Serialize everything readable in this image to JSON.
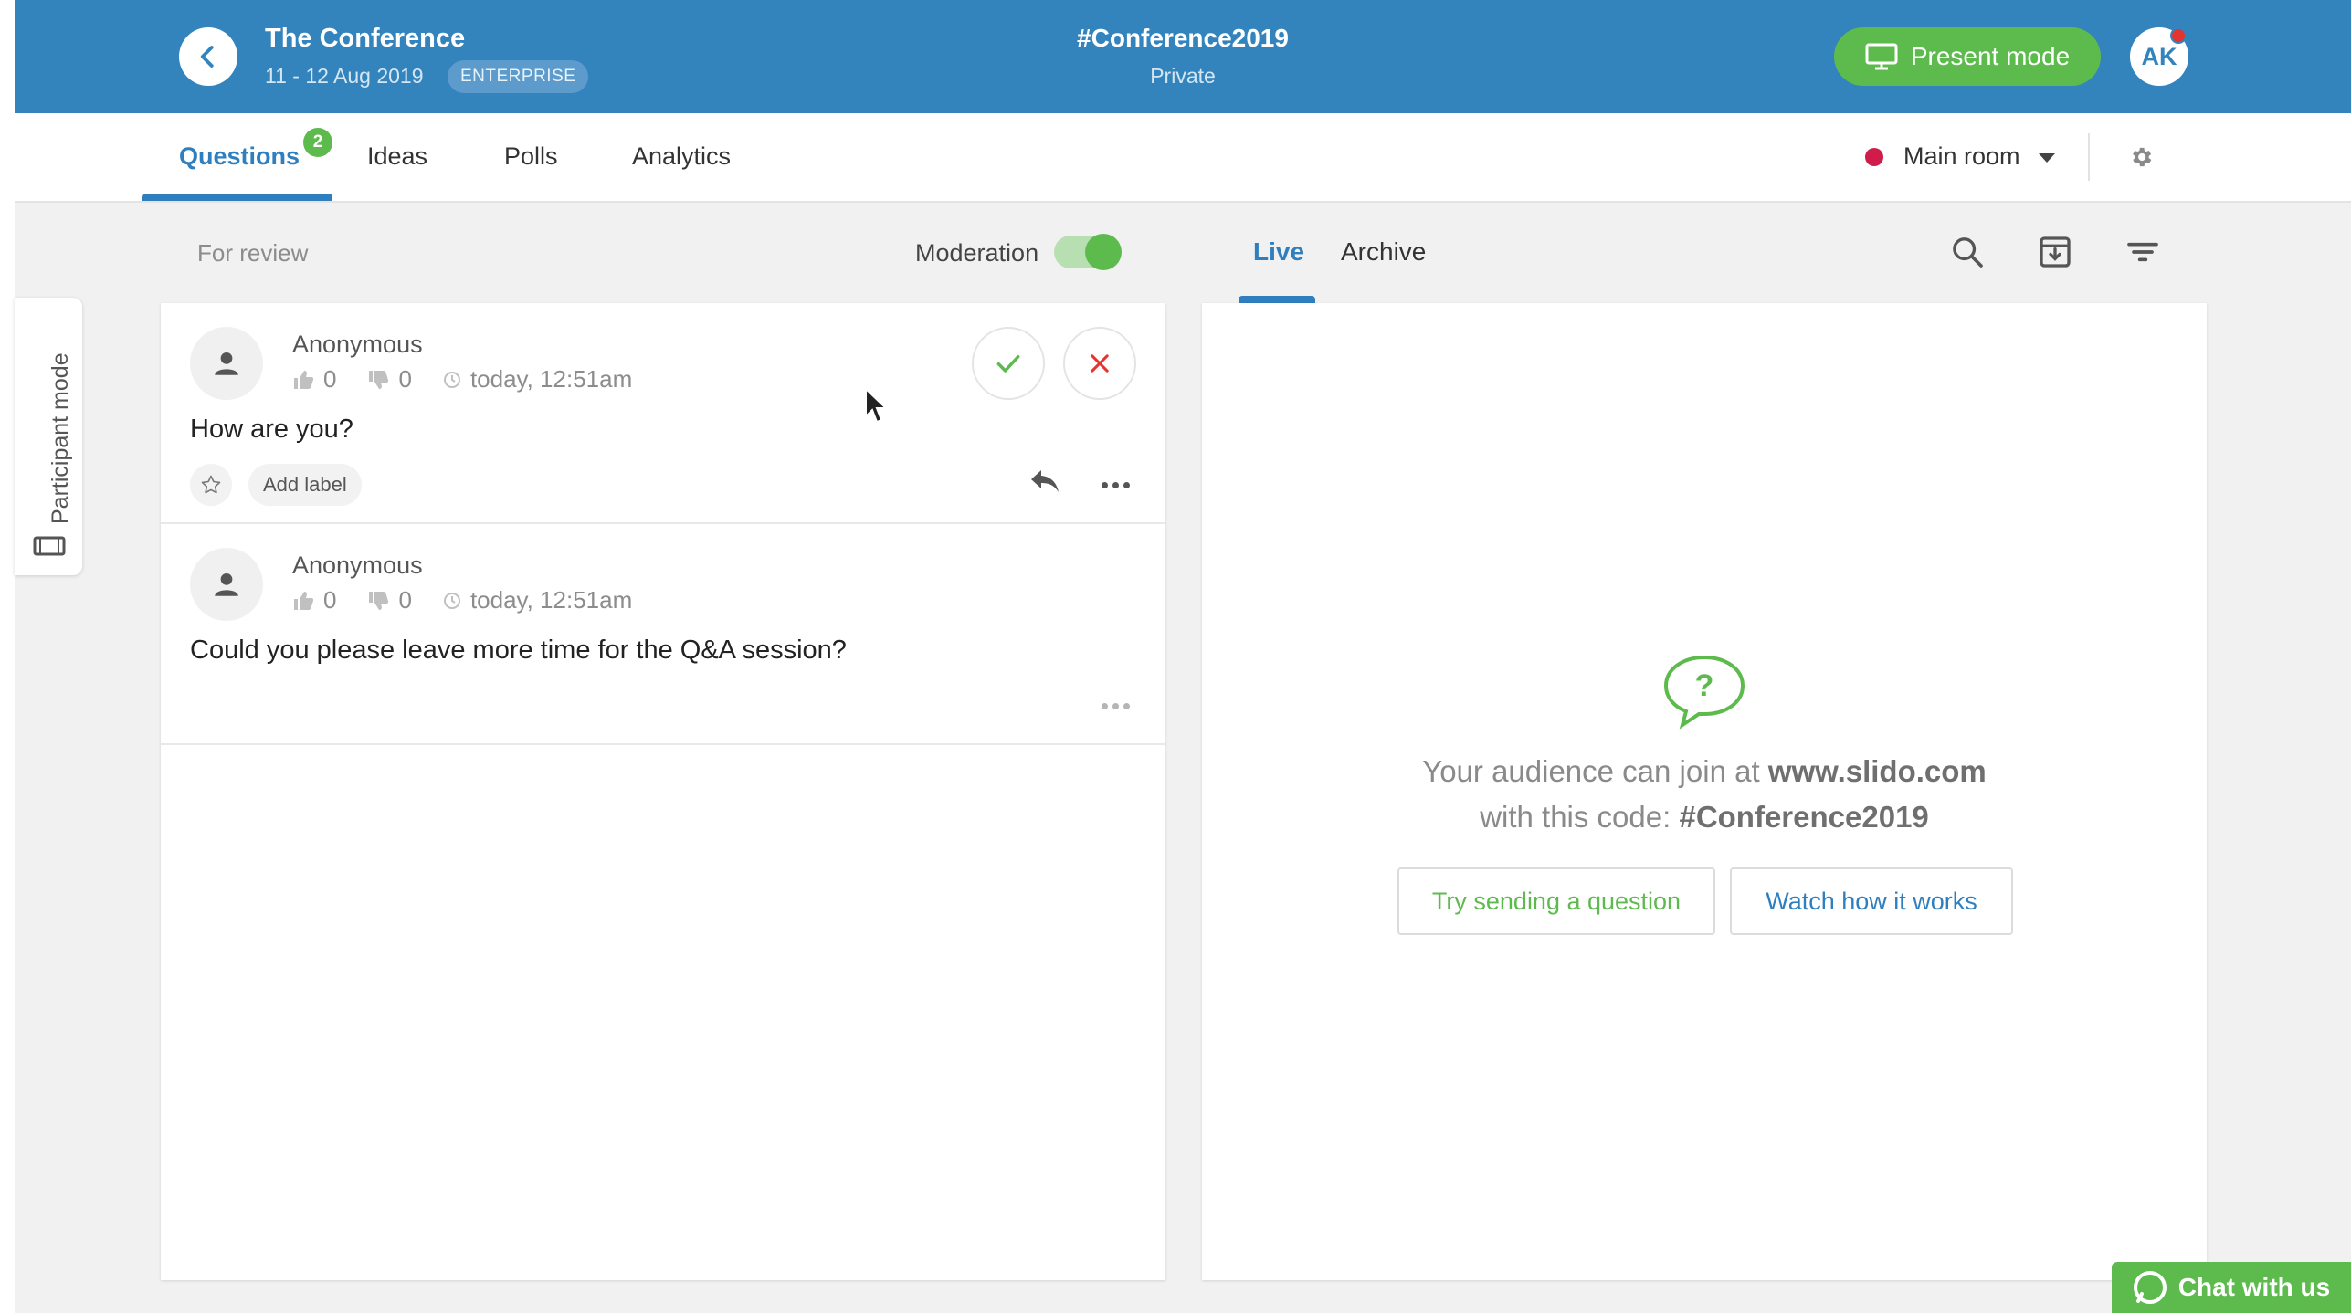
{
  "header": {
    "event_title": "The Conference",
    "event_dates": "11 - 12 Aug 2019",
    "plan_badge": "ENTERPRISE",
    "event_code": "#Conference2019",
    "event_privacy": "Private",
    "present_button": "Present mode",
    "avatar_initials": "AK"
  },
  "tabs": {
    "items": [
      {
        "label": "Questions",
        "active": true,
        "badge": "2"
      },
      {
        "label": "Ideas"
      },
      {
        "label": "Polls"
      },
      {
        "label": "Analytics"
      }
    ],
    "room_label": "Main room"
  },
  "review": {
    "heading": "For review",
    "moderation_label": "Moderation",
    "moderation_on": true
  },
  "participant_mode_label": "Participant mode",
  "questions": [
    {
      "author": "Anonymous",
      "upvotes": "0",
      "downvotes": "0",
      "time": "today, 12:51am",
      "text": "How are you?",
      "add_label": "Add label"
    },
    {
      "author": "Anonymous",
      "upvotes": "0",
      "downvotes": "0",
      "time": "today, 12:51am",
      "text": "Could you please leave more time for the Q&A session?"
    }
  ],
  "live": {
    "tabs": [
      "Live",
      "Archive"
    ],
    "join_prefix": "Your audience can join at ",
    "join_url": "www.slido.com",
    "code_prefix": "with this code: ",
    "code": "#Conference2019",
    "try_button": "Try sending a question",
    "watch_button": "Watch how it works"
  },
  "chat_widget": "Chat with us",
  "colors": {
    "header_blue": "#3383bd",
    "accent_green": "#5dbb4e",
    "link_blue": "#2f7fbf",
    "reject_red": "#e3342f",
    "room_dot": "#cf1c4a"
  },
  "icons": [
    "chevron-left-icon",
    "monitor-icon",
    "settings-gear-icon",
    "user-icon",
    "thumbs-up-icon",
    "thumbs-down-icon",
    "clock-icon",
    "check-icon",
    "close-icon",
    "star-icon",
    "reply-icon",
    "more-icon",
    "search-icon",
    "archive-icon",
    "filter-icon",
    "question-bubble-icon",
    "chat-bubble-icon",
    "screen-icon"
  ]
}
